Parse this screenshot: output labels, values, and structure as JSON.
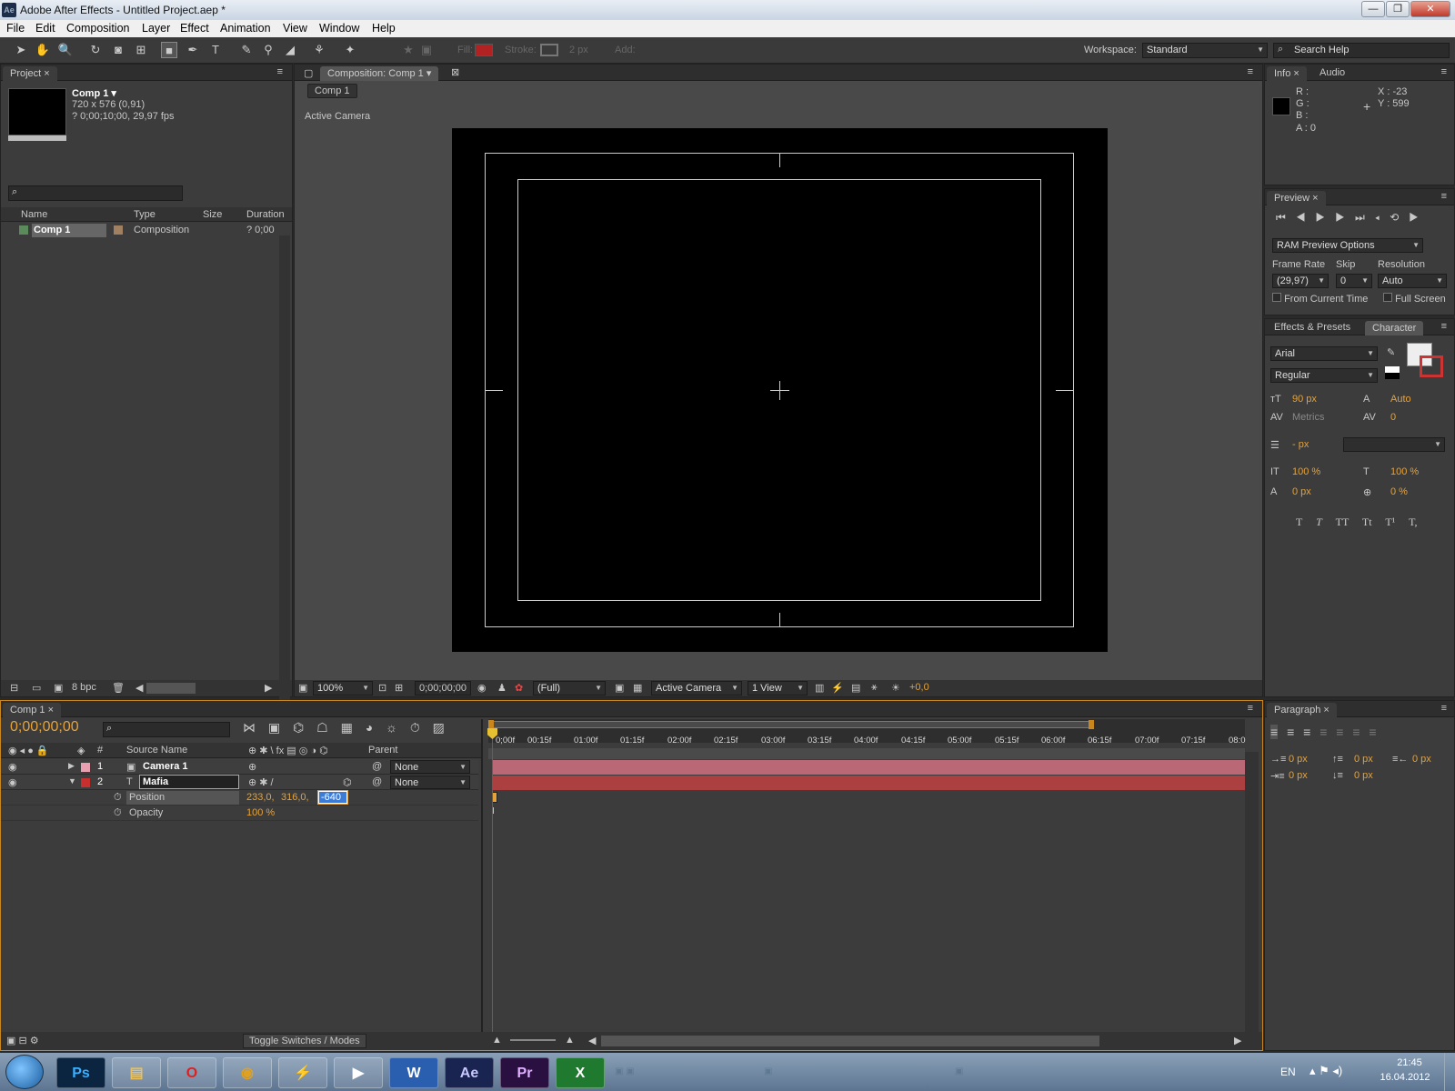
{
  "window": {
    "title": "Adobe After Effects - Untitled Project.aep *",
    "app_badge": "Ae",
    "buttons": [
      "—",
      "❐",
      "✕"
    ]
  },
  "menu": [
    "File",
    "Edit",
    "Composition",
    "Layer",
    "Effect",
    "Animation",
    "View",
    "Window",
    "Help"
  ],
  "toolbar": {
    "fill_label": "Fill:",
    "stroke_label": "Stroke:",
    "stroke_px": "2 px",
    "add_label": "Add:",
    "workspace_label": "Workspace:",
    "workspace_value": "Standard",
    "search_help": "Search Help",
    "fill_color": "#b22222"
  },
  "project": {
    "tab": "Project",
    "comp_name": "Comp 1 ▾",
    "comp_size": "720 x 576 (0,91)",
    "comp_duration": "? 0;00;10;00, 29,97 fps",
    "columns": [
      "Name",
      "Type",
      "Size",
      "Duration"
    ],
    "items": [
      {
        "name": "Comp 1",
        "type": "Composition",
        "size": "",
        "duration": "? 0;00"
      }
    ],
    "bpc": "8 bpc"
  },
  "composition": {
    "tab": "Composition: Comp 1",
    "breadcrumb": "Comp 1",
    "camera_label": "Active Camera",
    "zoom": "100%",
    "timecode": "0;00;00;00",
    "resolution": "(Full)",
    "view_camera": "Active Camera",
    "views": "1 View",
    "exposure": "+0,0"
  },
  "info": {
    "tabs": [
      "Info",
      "Audio"
    ],
    "r": "R :",
    "g": "G :",
    "b": "B :",
    "a": "A : 0",
    "x": "X : -23",
    "y": "Y : 599"
  },
  "preview": {
    "tab": "Preview",
    "ram_options": "RAM Preview Options",
    "frame_rate_label": "Frame Rate",
    "skip_label": "Skip",
    "resolution_label": "Resolution",
    "frame_rate": "(29,97)",
    "skip": "0",
    "resolution": "Auto",
    "from_current": "From Current Time",
    "full_screen": "Full Screen"
  },
  "character": {
    "tabs": [
      "Effects & Presets",
      "Character"
    ],
    "font": "Arial",
    "style": "Regular",
    "size": "90 px",
    "leading": "Auto",
    "kerning": "Metrics",
    "tracking": "0",
    "stroke_width": "- px",
    "vscale": "100 %",
    "hscale": "100 %",
    "baseline": "0 px",
    "tsume": "0 %",
    "styles": [
      "T",
      "T",
      "TT",
      "Tt",
      "T¹",
      "T,"
    ]
  },
  "paragraph": {
    "tab": "Paragraph",
    "indent": [
      "0 px",
      "0 px",
      "0 px",
      "0 px",
      "0 px"
    ]
  },
  "timeline": {
    "tab": "Comp 1",
    "timecode": "0;00;00;00",
    "col_source": "Source Name",
    "col_parent": "Parent",
    "col_hash": "#",
    "ruler": [
      "0;00f",
      "00:15f",
      "01:00f",
      "01:15f",
      "02:00f",
      "02:15f",
      "03:00f",
      "03:15f",
      "04:00f",
      "04:15f",
      "05:00f",
      "05:15f",
      "06:00f",
      "06:15f",
      "07:00f",
      "07:15f",
      "08:0"
    ],
    "layers": [
      {
        "num": "1",
        "name": "Camera 1",
        "parent": "None",
        "color": "#e8a0b0"
      },
      {
        "num": "2",
        "name": "Mafia",
        "parent": "None",
        "color": "#c83030"
      }
    ],
    "position_label": "Position",
    "position_x": "233,0,",
    "position_y": "316,0,",
    "position_z": "-640",
    "opacity_label": "Opacity",
    "opacity_value": "100 %",
    "toggle": "Toggle Switches / Modes"
  },
  "taskbar": {
    "apps": [
      "Ps",
      "",
      "",
      "",
      "",
      "",
      "W",
      "Ae",
      "Pr",
      "X"
    ],
    "lang": "EN",
    "time": "21:45",
    "date": "16.04.2012"
  }
}
